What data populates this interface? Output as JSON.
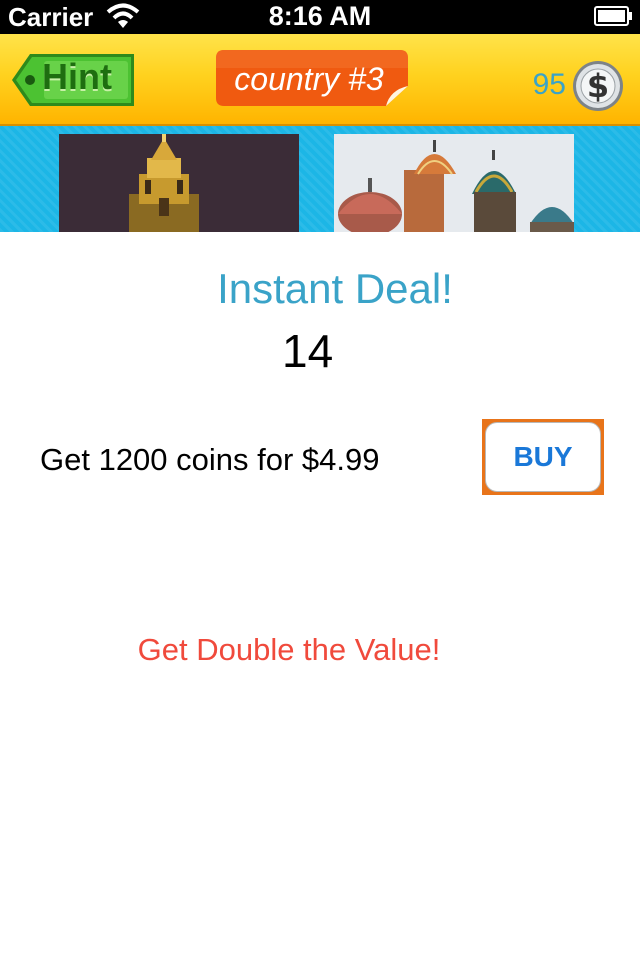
{
  "status_bar": {
    "carrier": "Carrier",
    "time": "8:16 AM"
  },
  "header": {
    "hint_label": "Hint",
    "puzzle_label": "country #3",
    "coin_count": "95",
    "colors": {
      "header_yellow": "#ffd21f",
      "hint_green": "#3fb62a",
      "tag_orange": "#f05a10",
      "coin_text": "#3aa3c8"
    }
  },
  "icons": {
    "hint": "hint-arrow-icon",
    "coin": "dollar-coin-icon",
    "wifi": "wifi-icon",
    "battery": "battery-icon"
  },
  "photos": [
    {
      "subject": "kremlin-tower"
    },
    {
      "subject": "onion-domes"
    }
  ],
  "deal": {
    "title": "Instant Deal!",
    "countdown": "14",
    "offer_text": "Get 1200 coins for $4.99",
    "buy_label": "BUY",
    "promo_text": "Get Double the Value!",
    "colors": {
      "title": "#3aa3c8",
      "promo": "#f04a3c",
      "buy_text": "#1a78d8",
      "buy_border": "#e8741a"
    }
  }
}
